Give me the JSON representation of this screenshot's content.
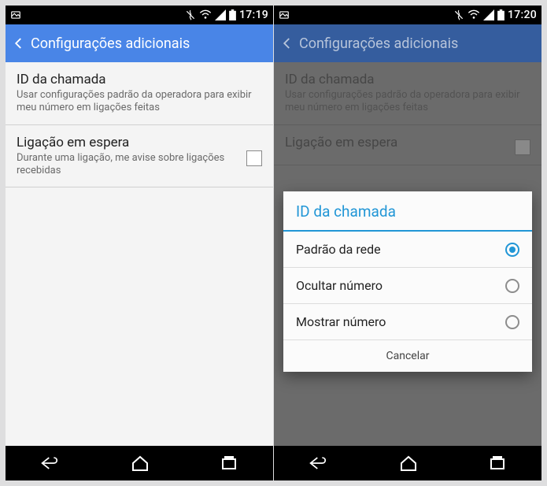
{
  "left": {
    "status": {
      "time": "17:19"
    },
    "header": {
      "title": "Configurações adicionais"
    },
    "settings": {
      "callerId": {
        "title": "ID da chamada",
        "subtitle": "Usar configurações padrão da operadora para exibir meu número em ligações feitas"
      },
      "callWaiting": {
        "title": "Ligação em espera",
        "subtitle": "Durante uma ligação, me avise sobre ligações recebidas"
      }
    }
  },
  "right": {
    "status": {
      "time": "17:20"
    },
    "header": {
      "title": "Configurações adicionais"
    },
    "settings": {
      "callerId": {
        "title": "ID da chamada",
        "subtitle": "Usar configurações padrão da operadora para exibir meu número em ligações feitas"
      },
      "callWaiting": {
        "title": "Ligação em espera"
      }
    },
    "dialog": {
      "title": "ID da chamada",
      "options": [
        {
          "label": "Padrão da rede",
          "selected": true
        },
        {
          "label": "Ocultar número",
          "selected": false
        },
        {
          "label": "Mostrar número",
          "selected": false
        }
      ],
      "cancel": "Cancelar"
    }
  }
}
